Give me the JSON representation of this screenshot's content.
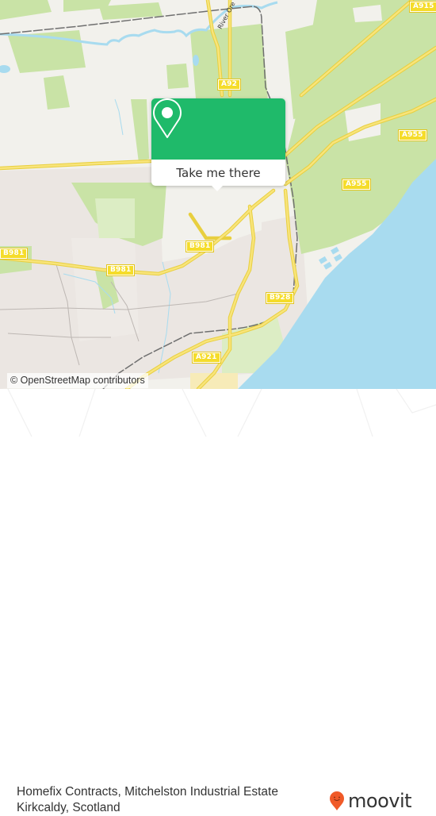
{
  "map": {
    "road_labels": [
      {
        "id": "a915",
        "text": "A915"
      },
      {
        "id": "a92",
        "text": "A92"
      },
      {
        "id": "a955-north",
        "text": "A955"
      },
      {
        "id": "a955-south",
        "text": "A955"
      },
      {
        "id": "b981-west",
        "text": "B981"
      },
      {
        "id": "b981-middle",
        "text": "B981"
      },
      {
        "id": "b981-east",
        "text": "B981"
      },
      {
        "id": "b928",
        "text": "B928"
      },
      {
        "id": "a921",
        "text": "A921"
      }
    ],
    "river_label": "River Ore",
    "attribution": "© OpenStreetMap contributors",
    "colors": {
      "land": "#f2f1ec",
      "green": "#c9e3a6",
      "water": "#a8dbef",
      "road": "#f5dc4a",
      "urban": "#ebe6e2"
    }
  },
  "popup": {
    "icon": "location-pin-icon",
    "button_label": "Take me there",
    "accent_color": "#1fba6a"
  },
  "footer": {
    "place_line1": "Homefix Contracts, Mitchelston Industrial Estate",
    "place_line2": "Kirkcaldy, Scotland",
    "brand": "moovit",
    "brand_color": "#f05a28"
  }
}
